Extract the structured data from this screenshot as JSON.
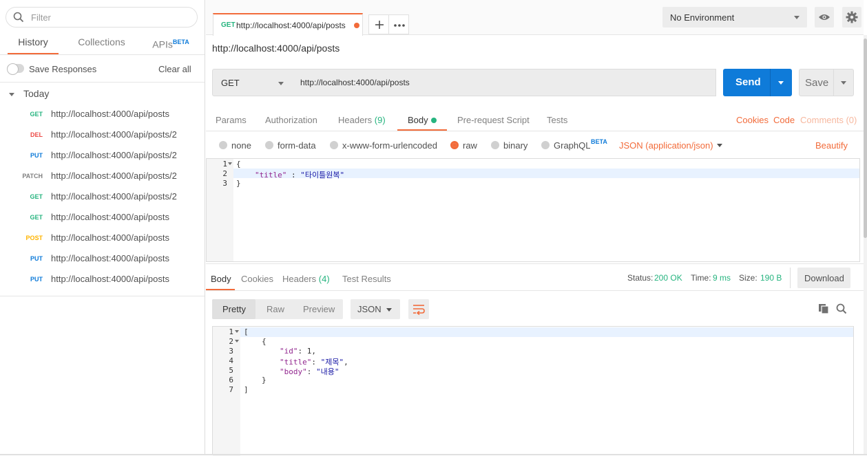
{
  "sidebar": {
    "filter_placeholder": "Filter",
    "tabs": [
      {
        "label": "History",
        "active": true
      },
      {
        "label": "Collections",
        "active": false
      },
      {
        "label": "APIs",
        "badge": "BETA",
        "active": false
      }
    ],
    "save_responses_label": "Save Responses",
    "clear_all_label": "Clear all",
    "group_label": "Today",
    "history": [
      {
        "method": "GET",
        "url": "http://localhost:4000/api/posts"
      },
      {
        "method": "DEL",
        "url": "http://localhost:4000/api/posts/2"
      },
      {
        "method": "PUT",
        "url": "http://localhost:4000/api/posts/2"
      },
      {
        "method": "PATCH",
        "url": "http://localhost:4000/api/posts/2"
      },
      {
        "method": "GET",
        "url": "http://localhost:4000/api/posts/2"
      },
      {
        "method": "GET",
        "url": "http://localhost:4000/api/posts"
      },
      {
        "method": "POST",
        "url": "http://localhost:4000/api/posts"
      },
      {
        "method": "PUT",
        "url": "http://localhost:4000/api/posts"
      },
      {
        "method": "PUT",
        "url": "http://localhost:4000/api/posts"
      }
    ]
  },
  "method_colors": {
    "GET": "#26b47f",
    "DEL": "#ed4b48",
    "PUT": "#0f7bd9",
    "PATCH": "#808080",
    "POST": "#ffb400"
  },
  "colors": {
    "accent": "#f26b3a",
    "primary": "#0f7bd9",
    "success": "#26b47f"
  },
  "tabbar": {
    "tab_method": "GET",
    "tab_url": "http://localhost:4000/api/posts",
    "environment": "No Environment"
  },
  "request": {
    "name": "http://localhost:4000/api/posts",
    "method": "GET",
    "url": "http://localhost:4000/api/posts",
    "send_label": "Send",
    "save_label": "Save",
    "tabs": {
      "params": "Params",
      "authorization": "Authorization",
      "headers": "Headers",
      "headers_count": "(9)",
      "body": "Body",
      "pre_request": "Pre-request Script",
      "tests": "Tests"
    },
    "links": {
      "cookies": "Cookies",
      "code": "Code",
      "comments": "Comments (0)"
    },
    "body_modes": {
      "none": "none",
      "form_data": "form-data",
      "urlencoded": "x-www-form-urlencoded",
      "raw": "raw",
      "binary": "binary",
      "graphql": "GraphQL",
      "graphql_badge": "BETA",
      "content_type": "JSON (application/json)",
      "beautify": "Beautify"
    },
    "body_lines": {
      "n1": "1",
      "n2": "2",
      "n3": "3",
      "l1": "{",
      "key": "\"title\"",
      "colon": " : ",
      "value": "\"타이틀원복\"",
      "l3": "}"
    }
  },
  "response": {
    "tabs": {
      "body": "Body",
      "cookies": "Cookies",
      "headers": "Headers",
      "headers_count": "(4)",
      "test_results": "Test Results"
    },
    "status_label": "Status:",
    "status_value": "200 OK",
    "time_label": "Time:",
    "time_value": "9 ms",
    "size_label": "Size:",
    "size_value": "190 B",
    "download_label": "Download",
    "views": {
      "pretty": "Pretty",
      "raw": "Raw",
      "preview": "Preview"
    },
    "format": "JSON",
    "lines": {
      "n1": "1",
      "n2": "2",
      "n3": "3",
      "n4": "4",
      "n5": "5",
      "n6": "6",
      "n7": "7",
      "l1": "[",
      "l2": "{",
      "id_key": "\"id\"",
      "id_rest": ": 1,",
      "title_key": "\"title\"",
      "title_sep": ": ",
      "title_val": "\"제목\"",
      "title_comma": ",",
      "body_key": "\"body\"",
      "body_sep": ": ",
      "body_val": "\"내용\"",
      "l6": "}",
      "l7": "]"
    }
  }
}
